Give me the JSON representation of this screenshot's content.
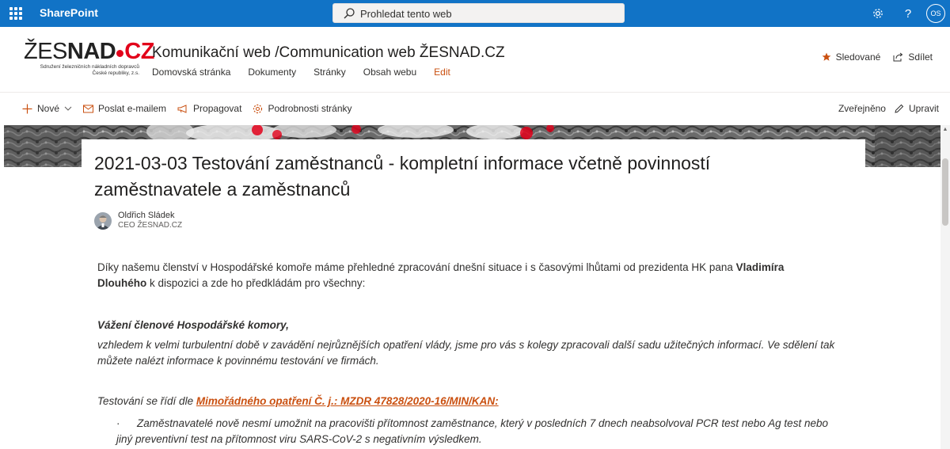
{
  "suite": {
    "brand": "SharePoint",
    "search_placeholder": "Prohledat tento web",
    "avatar_initials": "OS"
  },
  "site": {
    "logo_name_thin": "ŽES",
    "logo_name_bold": "NAD",
    "logo_tld": "CZ",
    "logo_sub1": "Sdružení železničních nákladních dopravců",
    "logo_sub2": "České republiky, z.s.",
    "title": "Komunikační web /Communication web ŽESNAD.CZ",
    "nav": [
      "Domovská stránka",
      "Dokumenty",
      "Stránky",
      "Obsah webu",
      "Edit"
    ],
    "follow_label": "Sledované",
    "share_label": "Sdílet"
  },
  "commandbar": {
    "new_label": "Nové",
    "email_label": "Poslat e-mailem",
    "promote_label": "Propagovat",
    "details_label": "Podrobnosti stránky",
    "status": "Zveřejněno",
    "edit_label": "Upravit"
  },
  "article": {
    "title": "2021-03-03 Testování zaměstnanců - kompletní informace včetně povinností zaměstnavatele a zaměstnanců",
    "author_name": "Oldřich Sládek",
    "author_role": "CEO ŽESNAD.CZ",
    "p1_text": "Díky našemu členství v Hospodářské komoře máme přehledné zpracování dnešní situace i s časovými lhůtami od prezidenta HK pana ",
    "p1_bold": "Vladimíra Dlouhého",
    "p1_end": " k dispozici a zde ho předkládám pro všechny:",
    "greeting": "Vážení členové Hospodářské komory,",
    "p3": "vzhledem k velmi turbulentní době v zavádění nejrůznějších opatření vlády, jsme pro vás s kolegy zpracovali další sadu užitečných informací. Ve sdělení tak můžete nalézt  informace k povinnému testování ve firmách.",
    "p4_text": "Testování se řídí dle ",
    "p4_link": "Mimořádného opatření Č. j.: MZDR 47828/2020-16/MIN/KAN:",
    "bullet_marker": "·",
    "p5": "Zaměstnavatelé nově nesmí umožnit na pracovišti přítomnost zaměstnance, který v posledních 7 dnech neabsolvoval PCR test nebo Ag test nebo jiný preventivní test na přítomnost viru SARS-CoV-2 s negativním výsledkem."
  },
  "colors": {
    "suite_blue": "#1173c6",
    "accent_orange": "#ca5010",
    "logo_red": "#e2001a"
  },
  "icons": [
    "waffle-icon",
    "search-icon",
    "settings-icon",
    "help-icon",
    "star-icon",
    "share-icon",
    "plus-icon",
    "chevron-down-icon",
    "mail-icon",
    "megaphone-icon",
    "gear-icon",
    "pencil-icon"
  ]
}
